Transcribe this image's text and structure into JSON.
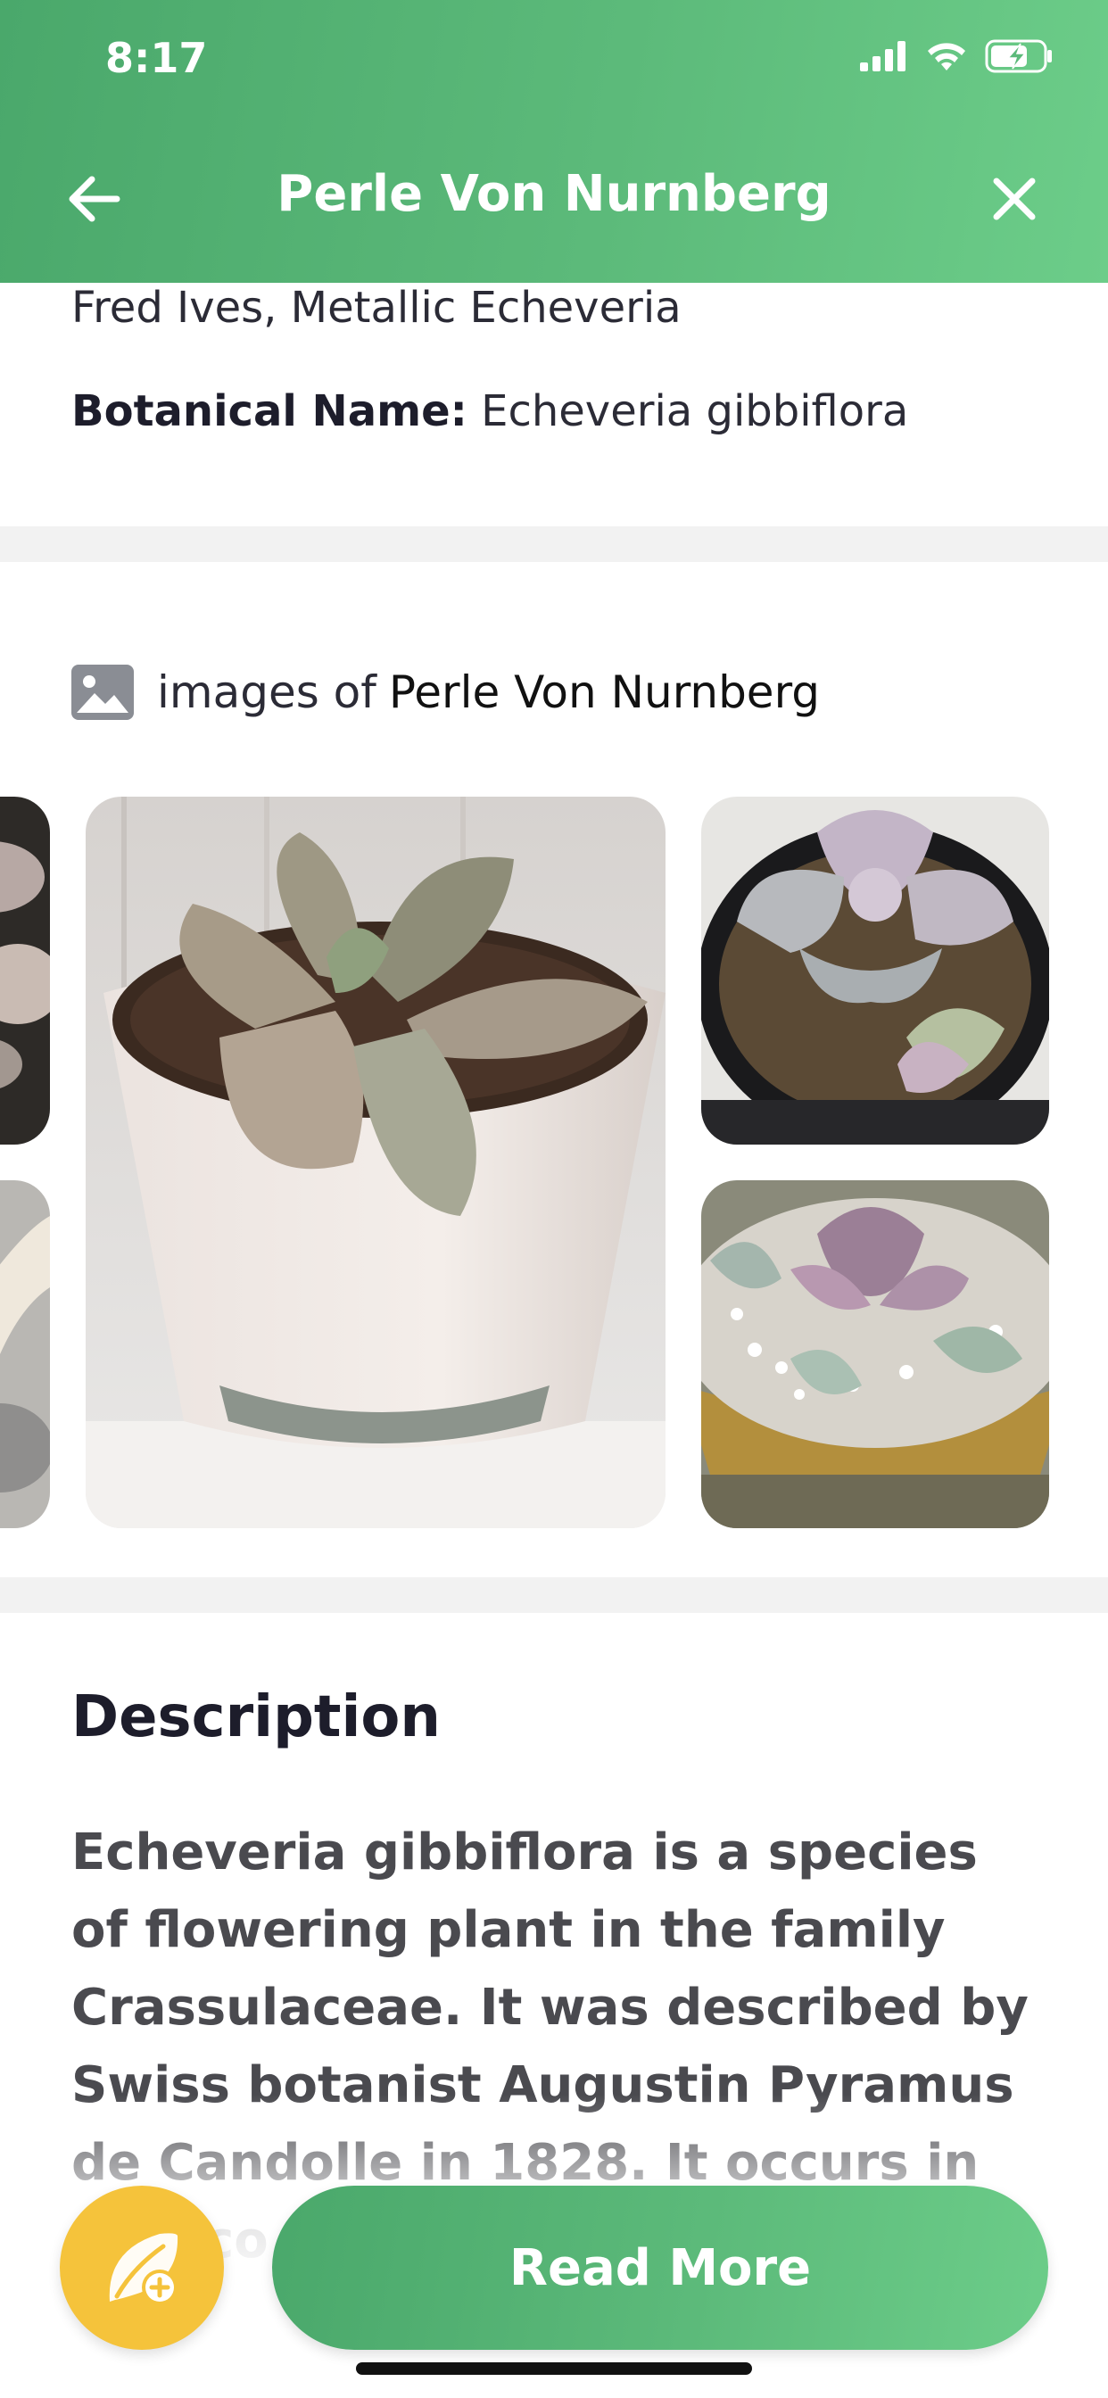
{
  "status_bar": {
    "time": "8:17"
  },
  "header": {
    "title": "Perle Von Nurnberg"
  },
  "names": {
    "aliases": "Fred Ives, Metallic Echeveria",
    "botanical_label": "Botanical Name:",
    "botanical_value": "Echeveria gibbiflora"
  },
  "images": {
    "heading_prefix": "images of",
    "heading_name": "Perle Von Nurnberg"
  },
  "description": {
    "heading": "Description",
    "text": "Echeveria gibbiflora is a species of flowering plant in the family Crassulaceae. It was described by Swiss botanist Augustin Pyramus de Candolle in 1828. It occurs in Mexico"
  },
  "actions": {
    "read_more": "Read More"
  },
  "colors": {
    "primary_green": "#5cba7a",
    "fab_yellow": "#f5c33b"
  }
}
